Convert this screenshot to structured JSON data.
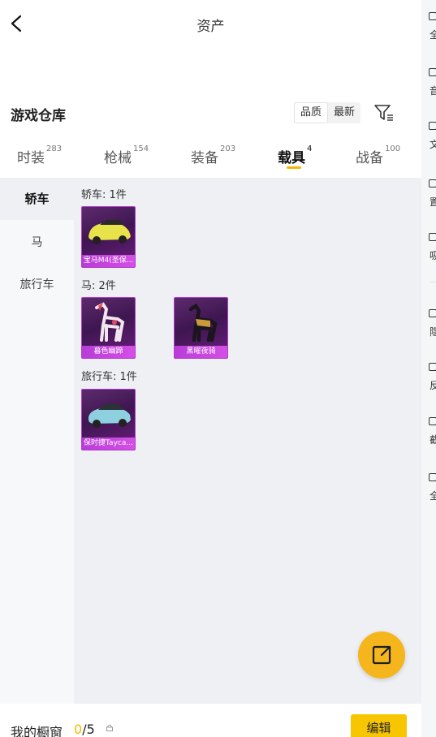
{
  "header": {
    "title": "资产"
  },
  "section": {
    "title": "游戏仓库",
    "sort_options": [
      "品质",
      "最新"
    ]
  },
  "tabs": [
    {
      "label": "时装",
      "count": "283"
    },
    {
      "label": "枪械",
      "count": "154"
    },
    {
      "label": "装备",
      "count": "203"
    },
    {
      "label": "载具",
      "count": "4"
    },
    {
      "label": "战备",
      "count": "100"
    }
  ],
  "sidebar": {
    "items": [
      {
        "label": "轿车"
      },
      {
        "label": "马"
      },
      {
        "label": "旅行车"
      }
    ]
  },
  "groups": [
    {
      "label": "轿车: 1件",
      "items": [
        {
          "name": "宝马M4(圣保..."
        }
      ]
    },
    {
      "label": "马: 2件",
      "items": [
        {
          "name": "暮色幽蹄"
        },
        {
          "name": "黑曜夜骑"
        }
      ]
    },
    {
      "label": "旅行车: 1件",
      "items": [
        {
          "name": "保时捷Tayca..."
        }
      ]
    }
  ],
  "bottom": {
    "label": "我的橱窗",
    "count_current": "0",
    "count_total": "/5",
    "edit_label": "编辑"
  },
  "right_panel": {
    "items": [
      "全",
      "音",
      "文",
      "置",
      "吸",
      "隐",
      "反",
      "截",
      "全"
    ]
  },
  "colors": {
    "accent": "#f5b800",
    "card_caption": "#c244dd",
    "fab": "#f5b51c"
  }
}
